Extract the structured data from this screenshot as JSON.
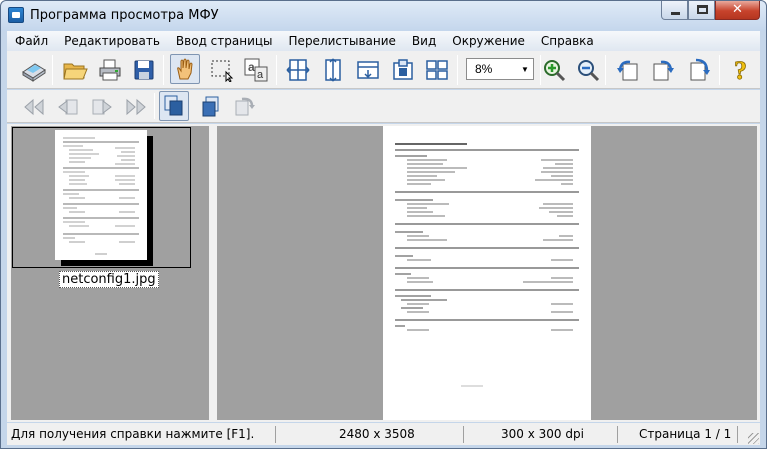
{
  "window": {
    "title": "Программа просмотра МФУ"
  },
  "menu": [
    "Файл",
    "Редактировать",
    "Ввод страницы",
    "Перелистывание",
    "Вид",
    "Окружение",
    "Справка"
  ],
  "toolbar": {
    "zoom_value": "8%"
  },
  "thumbnail": {
    "filename": "netconfig1.jpg"
  },
  "status": {
    "help": "Для получения справки нажмите [F1].",
    "dimensions": "2480 x 3508",
    "resolution": "300 x 300 dpi",
    "page": "Страница 1 / 1"
  },
  "colors": {
    "accent": "#1b5ea5",
    "pane_bg": "#a0a0a0",
    "toolbar_bg": "#f0f0f0"
  },
  "icons": {
    "toolbar1": [
      "scanner-icon",
      "open-folder-icon",
      "print-icon",
      "save-icon",
      "hand-tool-icon",
      "selection-rect-icon",
      "ocr-text-icon",
      "fit-width-icon",
      "fit-height-icon",
      "fit-page-icon",
      "actual-size-icon",
      "two-page-icon",
      "zoom-in-icon",
      "zoom-out-icon",
      "rotate-left-icon",
      "rotate-right-icon",
      "flip-icon",
      "help-icon"
    ],
    "toolbar2": [
      "first-page-icon",
      "previous-page-icon",
      "next-page-icon",
      "last-page-icon",
      "page-stack-icon",
      "page-stack-left-icon",
      "page-stack-right-icon"
    ]
  }
}
